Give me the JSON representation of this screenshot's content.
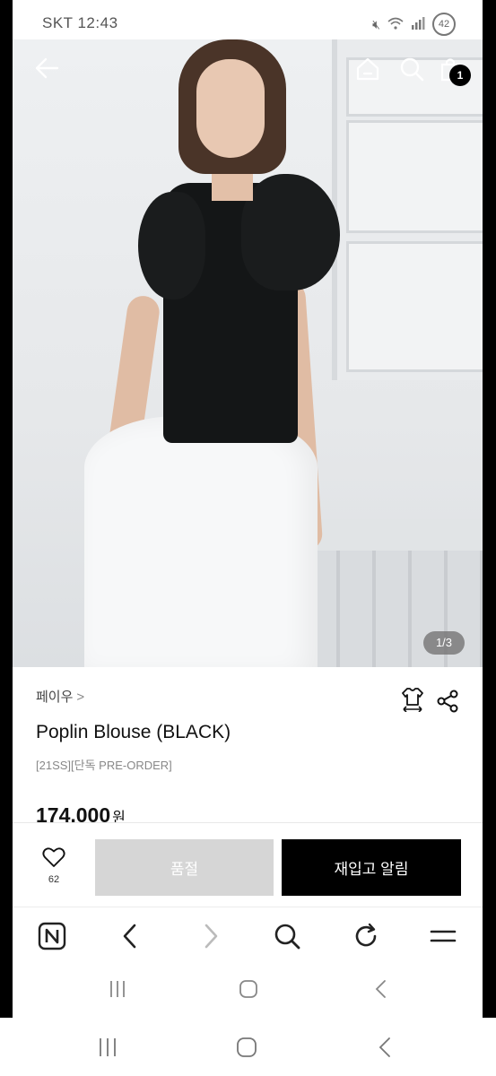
{
  "status_bar": {
    "carrier_time": "SKT 12:43",
    "battery": "42"
  },
  "hero": {
    "image_counter": "1/3",
    "cart_count": "1"
  },
  "product": {
    "brand": "페이우",
    "brand_chevron": ">",
    "title": "Poplin Blouse (BLACK)",
    "subtitle": "[21SS][단독 PRE-ORDER]",
    "price": "174,000",
    "currency": "원"
  },
  "buy_bar": {
    "like_count": "62",
    "sold_out_label": "품절",
    "restock_label": "재입고 알림"
  },
  "icons": {
    "back": "back-arrow-icon",
    "home": "home-icon",
    "search": "search-icon",
    "cart": "shopping-bag-icon",
    "size": "size-guide-icon",
    "share": "share-icon",
    "heart": "heart-icon"
  }
}
